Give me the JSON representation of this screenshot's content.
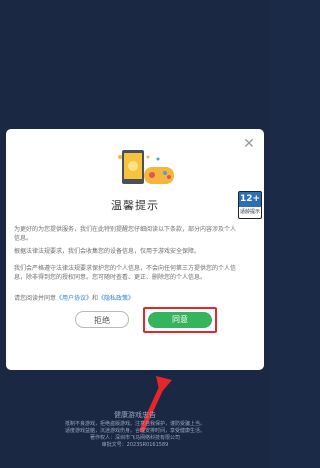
{
  "dialog": {
    "title": "温馨提示",
    "paragraphs": [
      "为更好的为您提供服务，我们在此特别提醒您仔细阅读以下条款，部分内容涉及个人信息。",
      "根据法律法规要求，我们会收集您的设备信息，仅用于游戏安全保障。",
      "我们会严格遵守法律法规要求保护您的个人信息，不会向任何第三方提供您的个人信息，除非得到您的授权同意。您可随时查看、更正、删除您的个人信息。"
    ],
    "agreement_prefix": "请您阅读并同意",
    "user_agreement_link": "《用户协议》",
    "and_text": "和",
    "privacy_policy_link": "《隐私政策》",
    "reject_label": "拒绝",
    "agree_label": "同意",
    "age_rating_top": "12+",
    "age_rating_bottom": "适龄提示",
    "accent_color": "#36b35d",
    "highlight_color": "#e5262b"
  },
  "footer": {
    "title": "健康游戏忠告",
    "lines": [
      "抵制不良游戏，拒绝盗版游戏。注意自我保护，谨防受骗上当。",
      "适度游戏益脑，沉迷游戏伤身。合理安排时间，享受健康生活。",
      "著作权人：深圳市飞马网络科技有限公司",
      "审批文号：2023SR0161589"
    ]
  }
}
